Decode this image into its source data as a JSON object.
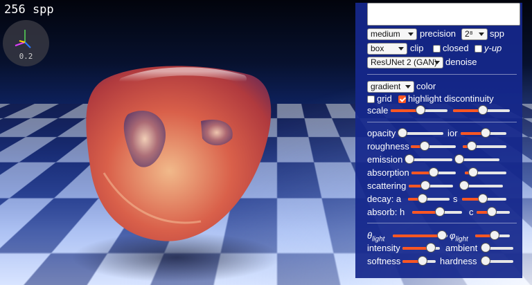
{
  "overlay": {
    "spp_counter": "256 spp",
    "axis_value": "0.2"
  },
  "colors": {
    "accent": "#ff5722",
    "panel": "#16288c"
  },
  "panel": {
    "notes": {
      "value": ""
    },
    "precision": {
      "value": "medium",
      "label": "precision"
    },
    "spp": {
      "value": "2⁸",
      "label": "spp"
    },
    "clip": {
      "value": "box",
      "label": "clip"
    },
    "closed": {
      "label": "closed",
      "checked": false
    },
    "y_up": {
      "label": "y-up",
      "checked": false
    },
    "denoise": {
      "value": "ResUNet 2 (GAN)",
      "label": "denoise"
    },
    "color": {
      "value": "gradient",
      "label": "color"
    },
    "grid": {
      "label": "grid",
      "checked": false
    },
    "highlight": {
      "label": "highlight discontinuity",
      "checked": true
    },
    "scale": {
      "label": "scale",
      "value_a": 0.52,
      "value_b": 0.52
    },
    "material": {
      "opacity": {
        "label": "opacity",
        "value": 0.0
      },
      "ior": {
        "label": "ior",
        "value": 0.55
      },
      "roughness": {
        "label": "roughness",
        "value": 0.3
      },
      "roughness_b": {
        "value": 0.2
      },
      "emission": {
        "label": "emission",
        "value": 0.0
      },
      "emission_b": {
        "value": 0.0
      },
      "absorption": {
        "label": "absorption",
        "value": 0.5
      },
      "absorption_b": {
        "value": 0.2
      },
      "scattering": {
        "label": "scattering",
        "value": 0.38
      },
      "scattering_b": {
        "value": 0.1
      },
      "decay_a": {
        "label": "decay: a",
        "value": 0.35
      },
      "decay_s": {
        "label": "s",
        "value": 0.47
      },
      "absorb_h": {
        "label": "absorb: h",
        "value": 0.56
      },
      "absorb_c": {
        "label": "c",
        "value": 0.45
      }
    },
    "light": {
      "theta": {
        "label_main": "θ",
        "label_sub": "light",
        "value": 0.9
      },
      "phi": {
        "label_main": "φ",
        "label_sub": "light",
        "value": 0.55
      },
      "intensity": {
        "label": "intensity",
        "value": 0.75
      },
      "ambient": {
        "label": "ambient",
        "value": 0.0
      },
      "softness": {
        "label": "softness",
        "value": 0.6
      },
      "hardness": {
        "label": "hardness",
        "value": 0.0
      }
    }
  }
}
